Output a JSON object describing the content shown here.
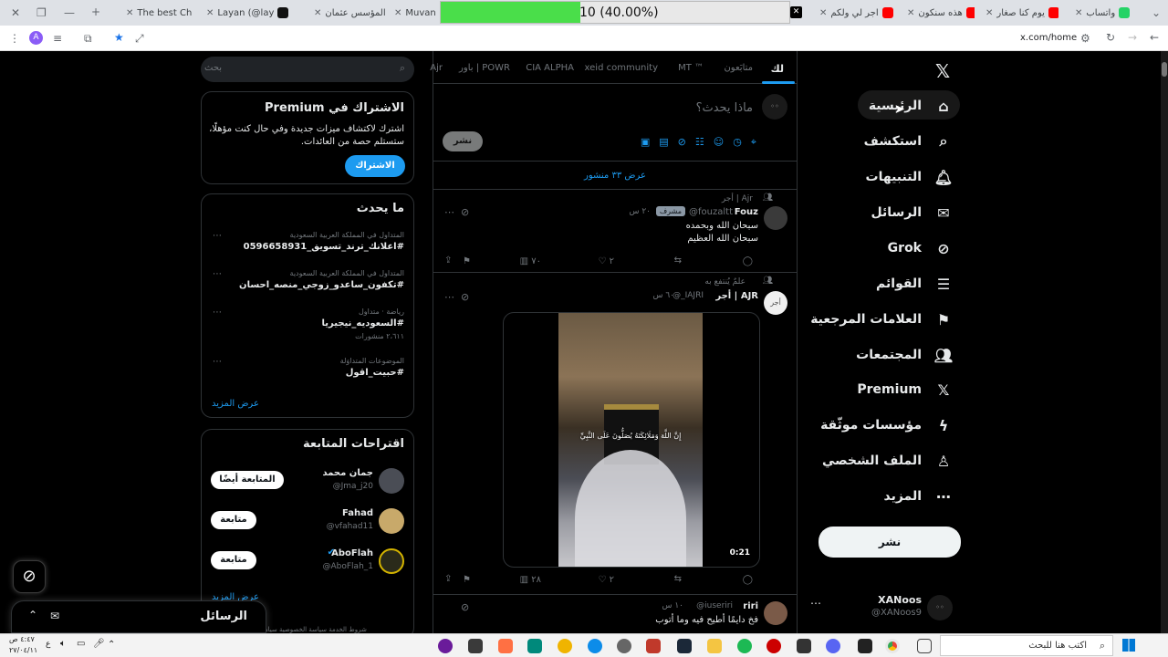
{
  "tabs": [
    {
      "label": "واتساب",
      "color": "#25d366"
    },
    {
      "label": "يوم كنا صغار",
      "color": "#ff0000"
    },
    {
      "label": "هذه سنكون",
      "color": "#ff0000"
    },
    {
      "label": "اجر لي ولكم",
      "color": "#ff0000"
    },
    {
      "label": "Muvan Sl",
      "color": "#cc3366"
    },
    {
      "label": "المؤسس عثمان",
      "color": "#cc3366"
    },
    {
      "label": "Layan (@lay",
      "color": "#111111"
    },
    {
      "label": "The best Ch",
      "color": "#555555"
    }
  ],
  "progress": {
    "text": "10 (40.00%)",
    "fraction": 0.4
  },
  "address": {
    "url": "x.com/home",
    "profile_initial": "A"
  },
  "nav": {
    "items": [
      {
        "label": "الرئيسية",
        "icon": "home-icon"
      },
      {
        "label": "استكشف",
        "icon": "search-icon"
      },
      {
        "label": "التنبيهات",
        "icon": "bell-icon"
      },
      {
        "label": "الرسائل",
        "icon": "mail-icon"
      },
      {
        "label": "Grok",
        "icon": "grok-icon"
      },
      {
        "label": "القوائم",
        "icon": "list-icon"
      },
      {
        "label": "العلامات المرجعية",
        "icon": "bookmark-icon"
      },
      {
        "label": "المجتمعات",
        "icon": "people-icon"
      },
      {
        "label": "Premium",
        "icon": "x-icon"
      },
      {
        "label": "مؤسسات موثّقة",
        "icon": "lightning-icon"
      },
      {
        "label": "الملف الشخصي",
        "icon": "person-icon"
      },
      {
        "label": "المزيد",
        "icon": "more-icon"
      }
    ],
    "post_button": "نشر",
    "account": {
      "name": "XANoos",
      "handle": "@XANoos9"
    }
  },
  "feed": {
    "tabs": [
      "لك",
      "متابَعون",
      "MT ™",
      "xeid community",
      "CIA ALPHA",
      "باور | POWR",
      "Ajr"
    ],
    "compose_placeholder": "ماذا يحدث؟",
    "compose_button": "نشر",
    "show_posts": "عرض ٣٣ منشور",
    "posts": [
      {
        "context": "Ajr | أجر",
        "name": "Fouz",
        "handle": "@fouzaltt",
        "badge": "مشرف",
        "time": "٢٠ س",
        "lines": [
          "سبحان الله وبحمده",
          "سبحان الله العظيم"
        ],
        "likes": "٢",
        "views": "٧٠"
      },
      {
        "context": "علمٌ يُنتفع به",
        "name": "AJR | أجر",
        "handle": "@_IAJRI",
        "time": "٦٠ س",
        "video_caption": "إِنَّ اللَّهَ وَمَلَائِكَتَهُ يُصَلُّونَ عَلَى النَّبِيِّ",
        "duration": "0:21",
        "likes": "٢",
        "views": "٢٨"
      },
      {
        "name": "riri",
        "handle": "@iuseriri",
        "time": "١٠ س",
        "lines": [
          "فخ دايمًا أطيح فيه وما أتوب"
        ]
      }
    ]
  },
  "sidebar": {
    "search_placeholder": "بحث",
    "premium": {
      "title": "الاشتراك في Premium",
      "text": "اشترك لاكتشاف ميزات جديدة وفي حال كنت مؤهلًا، ستستلم حصة من العائدات.",
      "button": "الاشتراك"
    },
    "trends": {
      "title": "ما يحدث",
      "items": [
        {
          "meta": "المتداول في المملكة العربية السعودية",
          "tag": "#اعلانك_ترند_تسويق_0596658931",
          "count": ""
        },
        {
          "meta": "المتداول في المملكة العربية السعودية",
          "tag": "#تكفون_ساعدو_زوجي_منصه_احسان",
          "count": ""
        },
        {
          "meta": "رياضة · متداول",
          "tag": "#السعوديه_نيجيريا",
          "count": "٢،٦١١ منشورات"
        },
        {
          "meta": "الموضوعات المتداوَلة",
          "tag": "#حبيت_اقول",
          "count": ""
        }
      ],
      "show_more": "عرض المزيد"
    },
    "follow": {
      "title": "اقتراحات المتابعة",
      "users": [
        {
          "name": "جمان محمد",
          "handle": "@Jma_j20",
          "button": "المتابعة أيضًا"
        },
        {
          "name": "Fahad",
          "handle": "@vfahad11",
          "button": "متابعة"
        },
        {
          "name": "AboFlah",
          "handle": "@AboFlah_1",
          "button": "متابعة"
        }
      ],
      "show_more": "عرض المزيد"
    },
    "footer": "شروط الخدمة   سياسة الخصوصية   سياسة"
  },
  "messages_drawer": {
    "title": "الرسائل"
  },
  "taskbar": {
    "search_placeholder": "اكتب هنا للبحث",
    "time": "٤:٤٧ ص",
    "date": "٢٧/٠٤/١١",
    "lang": "ع"
  }
}
